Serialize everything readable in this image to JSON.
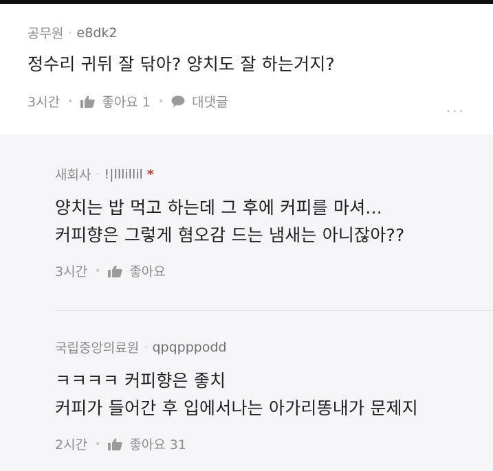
{
  "comments": [
    {
      "author": "공무원",
      "user_id": "e8dk2",
      "lines": [
        "정수리 귀뒤 잘 닦아? 양치도 잘 하는거지?"
      ],
      "time": "3시간",
      "like_label": "좋아요 1",
      "reply_label": "대댓글",
      "more_label": "..."
    }
  ],
  "replies": [
    {
      "author": "새회사",
      "user_id": "!|lllillil",
      "badge": "*",
      "lines": [
        "양치는 밥 먹고 하는데 그 후에 커피를 마셔...",
        "커피향은 그렇게 혐오감 드는 냄새는 아니잖아??"
      ],
      "time": "3시간",
      "like_label": "좋아요"
    },
    {
      "author": "국립중앙의료원",
      "user_id": "qpqpppodd",
      "lines": [
        "ㅋㅋㅋㅋ 커피향은 좋치",
        "커피가 들어간 후 입에서나는 아가리똥내가 문제지"
      ],
      "time": "2시간",
      "like_label": "좋아요 31"
    }
  ],
  "icons": {
    "like": "thumbs-up-icon",
    "reply": "speech-bubble-icon",
    "more": "more-dots-icon"
  },
  "colors": {
    "badge": "#d33a2c",
    "meta_text": "#8b8b8b",
    "body_text": "#1e1e1e",
    "reply_bg": "#f5f5f7"
  }
}
